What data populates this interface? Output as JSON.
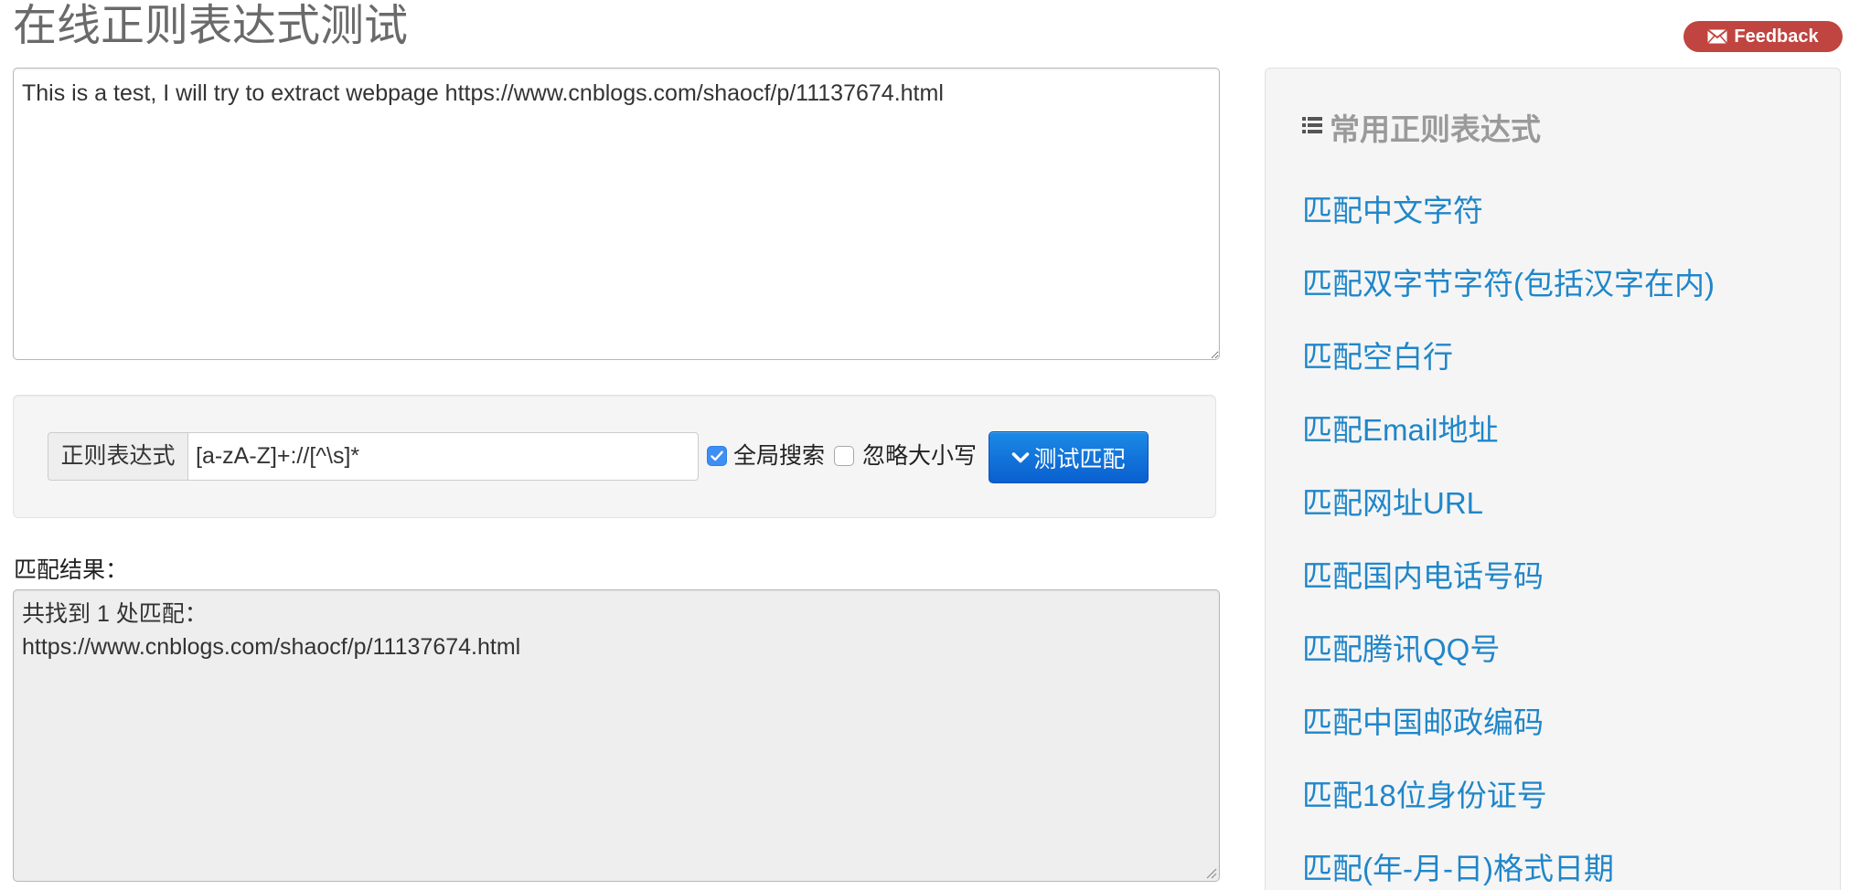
{
  "page": {
    "title": "在线正则表达式测试"
  },
  "feedback": {
    "label": "Feedback",
    "icon": "envelope-icon",
    "color": "#c0443f"
  },
  "source": {
    "text": "This is a test, I will try to extract webpage https://www.cnblogs.com/shaocf/p/11137674.html"
  },
  "regex": {
    "label": "正则表达式",
    "value": "[a-zA-Z]+://[^\\s]*",
    "global": {
      "label": "全局搜索",
      "checked": true
    },
    "ignore_case": {
      "label": "忽略大小写",
      "checked": false
    },
    "test_button": {
      "label": "测试匹配",
      "icon": "chevron-down-icon",
      "color": "#0a6fd6"
    }
  },
  "result": {
    "label": "匹配结果：",
    "summary": "共找到 1 处匹配：",
    "matches": [
      "https://www.cnblogs.com/shaocf/p/11137674.html"
    ]
  },
  "sidebar": {
    "heading": "常用正则表达式",
    "icon": "list-icon",
    "link_color": "#1f86c9",
    "items": [
      "匹配中文字符",
      "匹配双字节字符(包括汉字在内)",
      "匹配空白行",
      "匹配Email地址",
      "匹配网址URL",
      "匹配国内电话号码",
      "匹配腾讯QQ号",
      "匹配中国邮政编码",
      "匹配18位身份证号",
      "匹配(年-月-日)格式日期"
    ]
  }
}
